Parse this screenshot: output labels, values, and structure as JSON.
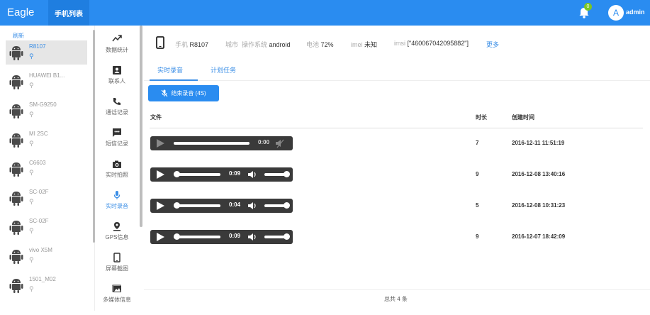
{
  "topbar": {
    "brand": "Eagle",
    "nav_tab": "手机列表",
    "notification_count": "0",
    "avatar_letter": "A",
    "user": "admin"
  },
  "device_list": {
    "refresh_label": "刷新",
    "devices": [
      {
        "name": "R8107",
        "selected": true
      },
      {
        "name": "HUAWEI B1..."
      },
      {
        "name": "SM-G9250"
      },
      {
        "name": "MI 2SC"
      },
      {
        "name": "C6603"
      },
      {
        "name": "SC-02F"
      },
      {
        "name": "SC-02F"
      },
      {
        "name": "vivo X5M"
      },
      {
        "name": "1501_M02"
      }
    ]
  },
  "functions": [
    {
      "label": "数据统计",
      "icon": "stats-icon"
    },
    {
      "label": "联系人",
      "icon": "contacts-icon"
    },
    {
      "label": "通话记录",
      "icon": "phone-call-icon"
    },
    {
      "label": "短信记录",
      "icon": "sms-icon"
    },
    {
      "label": "实时拍照",
      "icon": "camera-icon"
    },
    {
      "label": "实时录音",
      "icon": "microphone-icon",
      "active": true
    },
    {
      "label": "GPS信息",
      "icon": "gps-icon"
    },
    {
      "label": "屏幕截图",
      "icon": "screenshot-icon"
    },
    {
      "label": "多媒体信息",
      "icon": "media-icon"
    }
  ],
  "device_info": {
    "phone_label": "手机",
    "phone_value": "R8107",
    "city_label": "城市",
    "os_label": "操作系统",
    "os_value": "android",
    "battery_label": "电池",
    "battery_value": "72%",
    "imei_label": "imei",
    "imei_value": "未知",
    "imsi_label": "imsi",
    "imsi_value": "[\"460067042095882\"]",
    "more_label": "更多"
  },
  "tabs": {
    "realtime": "实时录音",
    "scheduled": "计划任务"
  },
  "stop_button": "结束录音 (4S)",
  "table": {
    "headers": {
      "file": "文件",
      "duration": "时长",
      "created": "创建时间"
    },
    "rows": [
      {
        "time": "0:00",
        "duration": "7",
        "created": "2016-12-11 11:51:19",
        "progress": 1.0,
        "enabled": false
      },
      {
        "time": "0:09",
        "duration": "9",
        "created": "2016-12-08 13:40:16",
        "progress": 0.0,
        "enabled": true
      },
      {
        "time": "0:04",
        "duration": "5",
        "created": "2016-12-08 10:31:23",
        "progress": 0.0,
        "enabled": true
      },
      {
        "time": "0:09",
        "duration": "9",
        "created": "2016-12-07 18:42:09",
        "progress": 0.0,
        "enabled": true
      }
    ]
  },
  "footer": {
    "total": "总共 4 条"
  },
  "colors": {
    "primary": "#2a8cf0",
    "link": "#3a8ee6",
    "player_bg": "#3a3a3a",
    "badge": "#7cc623"
  }
}
